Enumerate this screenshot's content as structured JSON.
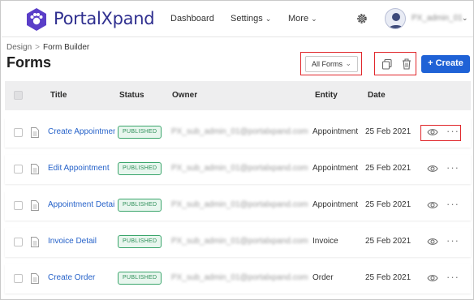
{
  "brand": {
    "name": "PortalXpand",
    "accent": "#2f2f8f",
    "logo_color": "#5a3ec8"
  },
  "nav": {
    "items": [
      {
        "label": "Dashboard",
        "has_dropdown": false
      },
      {
        "label": "Settings",
        "has_dropdown": true
      },
      {
        "label": "More",
        "has_dropdown": true
      }
    ],
    "settings_icon": "gear-icon",
    "user": {
      "name": "PX_admin_01",
      "avatar_icon": "user-avatar-icon"
    }
  },
  "breadcrumb": {
    "parent": "Design",
    "current": "Form Builder"
  },
  "page": {
    "title": "Forms"
  },
  "toolbar": {
    "filter_value": "All Forms",
    "copy_icon": "copy-icon",
    "delete_icon": "trash-icon",
    "create_label": "+ Create",
    "create_color": "#1f62d6"
  },
  "table": {
    "columns": [
      "Title",
      "Status",
      "Owner",
      "Entity",
      "Date"
    ],
    "rows": [
      {
        "title": "Create Appointment",
        "status": "PUBLISHED",
        "owner": "PX_sub_admin_01@portalxpand.com",
        "entity": "Appointment",
        "date": "25 Feb 2021"
      },
      {
        "title": "Edit Appointment",
        "status": "PUBLISHED",
        "owner": "PX_sub_admin_01@portalxpand.com",
        "entity": "Appointment",
        "date": "25 Feb 2021"
      },
      {
        "title": "Appointment Detail",
        "status": "PUBLISHED",
        "owner": "PX_sub_admin_01@portalxpand.com",
        "entity": "Appointment",
        "date": "25 Feb 2021"
      },
      {
        "title": "Invoice Detail",
        "status": "PUBLISHED",
        "owner": "PX_sub_admin_01@portalxpand.com",
        "entity": "Invoice",
        "date": "25 Feb 2021"
      },
      {
        "title": "Create Order",
        "status": "PUBLISHED",
        "owner": "PX_sub_admin_01@portalxpand.com",
        "entity": "Order",
        "date": "25 Feb 2021"
      }
    ],
    "row_actions": {
      "view_icon": "eye-icon",
      "more_label": "···"
    },
    "status_color": "#2e8f59",
    "link_color": "#2662c9"
  }
}
